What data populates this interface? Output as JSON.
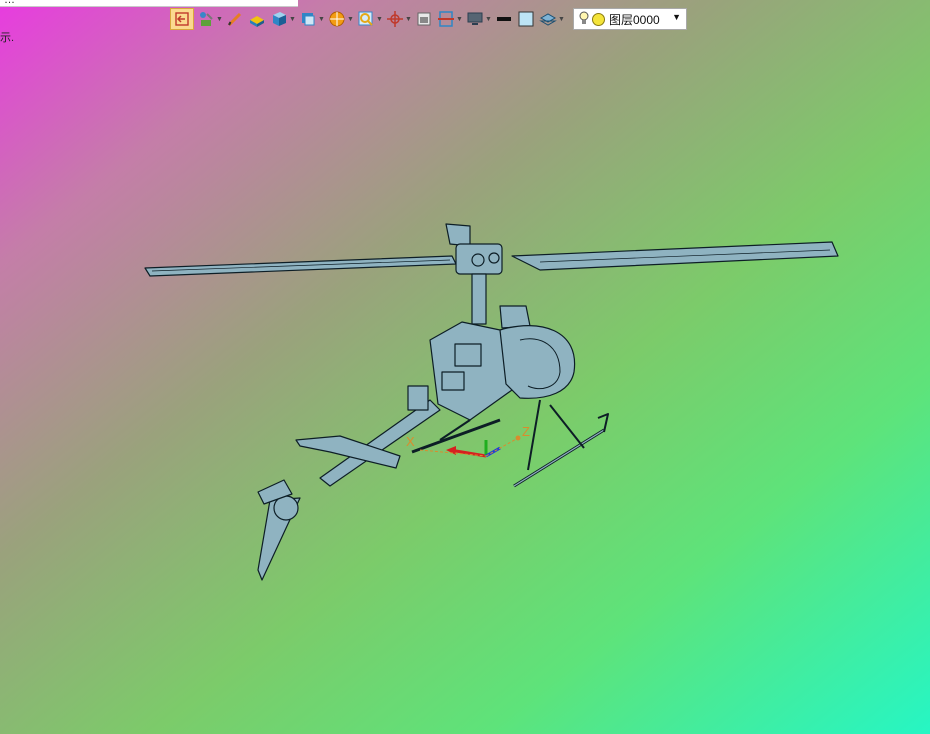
{
  "top_strip": {
    "text": "…"
  },
  "left_label": "示.",
  "toolbar": {
    "items": [
      {
        "name": "active-tool",
        "icon": "undo-arrow-icon"
      },
      {
        "name": "snap-tool",
        "icon": "snap-icon"
      },
      {
        "name": "pencil-tool",
        "icon": "pencil-icon"
      },
      {
        "name": "solid-tool",
        "icon": "solid-icon"
      },
      {
        "name": "cube-tool",
        "icon": "cube-icon"
      },
      {
        "name": "view-tool",
        "icon": "view-icon"
      },
      {
        "name": "render-tool",
        "icon": "sphere-icon"
      },
      {
        "name": "zoom-tool",
        "icon": "zoom-icon"
      },
      {
        "name": "origin-tool",
        "icon": "crosshair-icon"
      },
      {
        "name": "frame-tool",
        "icon": "frame-icon"
      },
      {
        "name": "section-tool",
        "icon": "section-icon"
      },
      {
        "name": "display-tool",
        "icon": "monitor-icon"
      },
      {
        "name": "line-tool",
        "icon": "line-icon"
      },
      {
        "name": "color-tool",
        "icon": "color-swatch-icon"
      },
      {
        "name": "layer-tool",
        "icon": "layers-icon"
      }
    ],
    "layer_select": {
      "value": "图层0000"
    }
  },
  "triad": {
    "x_label": "X",
    "z_label": "Z"
  },
  "colors": {
    "toolbar_accent": "#fbd98f",
    "model_fill": "#8fb3c1",
    "model_edge": "#0d1e26"
  }
}
